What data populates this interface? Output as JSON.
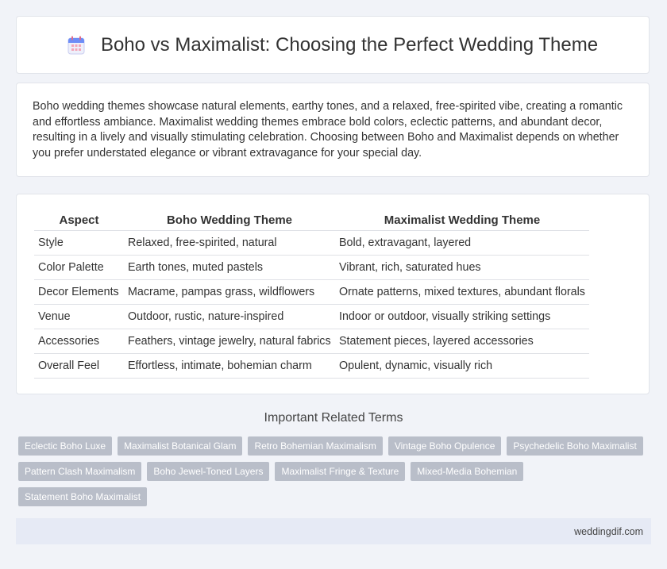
{
  "header": {
    "icon": "calendar-icon",
    "title": "Boho vs Maximalist: Choosing the Perfect Wedding Theme"
  },
  "intro": {
    "text": "Boho wedding themes showcase natural elements, earthy tones, and a relaxed, free-spirited vibe, creating a romantic and effortless ambiance. Maximalist wedding themes embrace bold colors, eclectic patterns, and abundant decor, resulting in a lively and visually stimulating celebration. Choosing between Boho and Maximalist depends on whether you prefer understated elegance or vibrant extravagance for your special day."
  },
  "table": {
    "headers": [
      "Aspect",
      "Boho Wedding Theme",
      "Maximalist Wedding Theme"
    ],
    "rows": [
      [
        "Style",
        "Relaxed, free-spirited, natural",
        "Bold, extravagant, layered"
      ],
      [
        "Color Palette",
        "Earth tones, muted pastels",
        "Vibrant, rich, saturated hues"
      ],
      [
        "Decor Elements",
        "Macrame, pampas grass, wildflowers",
        "Ornate patterns, mixed textures, abundant florals"
      ],
      [
        "Venue",
        "Outdoor, rustic, nature-inspired",
        "Indoor or outdoor, visually striking settings"
      ],
      [
        "Accessories",
        "Feathers, vintage jewelry, natural fabrics",
        "Statement pieces, layered accessories"
      ],
      [
        "Overall Feel",
        "Effortless, intimate, bohemian charm",
        "Opulent, dynamic, visually rich"
      ]
    ]
  },
  "related": {
    "title": "Important Related Terms",
    "tags": [
      "Eclectic Boho Luxe",
      "Maximalist Botanical Glam",
      "Retro Bohemian Maximalism",
      "Vintage Boho Opulence",
      "Psychedelic Boho Maximalist",
      "Pattern Clash Maximalism",
      "Boho Jewel-Toned Layers",
      "Maximalist Fringe & Texture",
      "Mixed-Media Bohemian",
      "Statement Boho Maximalist"
    ]
  },
  "footer": {
    "site": "weddingdif.com"
  }
}
